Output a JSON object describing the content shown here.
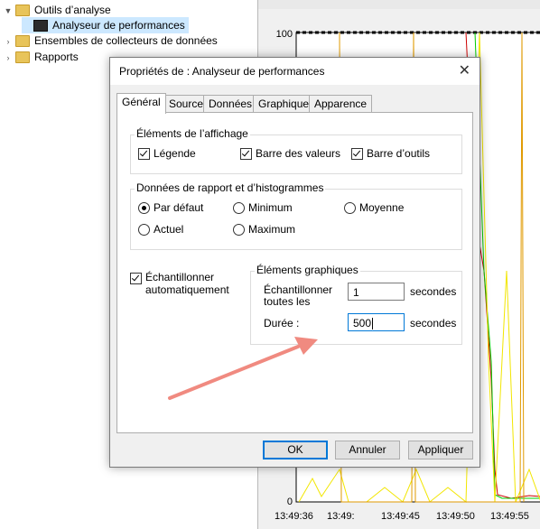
{
  "tree": {
    "items": [
      {
        "label": "Outils d’analyse",
        "icon": "folder-icon",
        "expander": "▼"
      },
      {
        "label": "Analyseur de performances",
        "icon": "performance-monitor-icon",
        "expander": ""
      },
      {
        "label": "Ensembles de collecteurs de données",
        "icon": "folder-icon",
        "expander": "›"
      },
      {
        "label": "Rapports",
        "icon": "folder-icon",
        "expander": "›"
      }
    ]
  },
  "graph": {
    "y_top_label": "100",
    "y_bottom_label": "0",
    "x_labels": [
      "13:49:36",
      "13:49:",
      "13:49:45",
      "13:49:50",
      "13:49:55"
    ],
    "colors": {
      "yellow": "#f2e600",
      "green": "#00cc00",
      "red": "#cc0000",
      "orange": "#e09a00"
    }
  },
  "dialog": {
    "title": "Propriétés de : Analyseur de performances",
    "close_glyph": "✕",
    "tabs": [
      {
        "label": "Général",
        "active": true
      },
      {
        "label": "Source",
        "active": false
      },
      {
        "label": "Données",
        "active": false
      },
      {
        "label": "Graphique",
        "active": false
      },
      {
        "label": "Apparence",
        "active": false
      }
    ],
    "display_group": {
      "title": "Éléments de l’affichage",
      "legend": "Légende",
      "value_bar": "Barre des valeurs",
      "toolbar": "Barre d’outils"
    },
    "report_group": {
      "title": "Données de rapport et d’histogrammes",
      "default": "Par défaut",
      "minimum": "Minimum",
      "average": "Moyenne",
      "current": "Actuel",
      "maximum": "Maximum",
      "selected": "Par défaut"
    },
    "auto_sample": {
      "label_line1": "Échantillonner",
      "label_line2": "automatiquement",
      "checked": true
    },
    "graph_elements": {
      "title": "Éléments graphiques",
      "sample_label_line1": "Échantillonner",
      "sample_label_line2": "toutes les",
      "sample_value": "1",
      "sample_unit": "secondes",
      "duration_label": "Durée :",
      "duration_value": "500",
      "duration_unit": "secondes"
    },
    "buttons": {
      "ok": "OK",
      "cancel": "Annuler",
      "apply": "Appliquer"
    }
  }
}
